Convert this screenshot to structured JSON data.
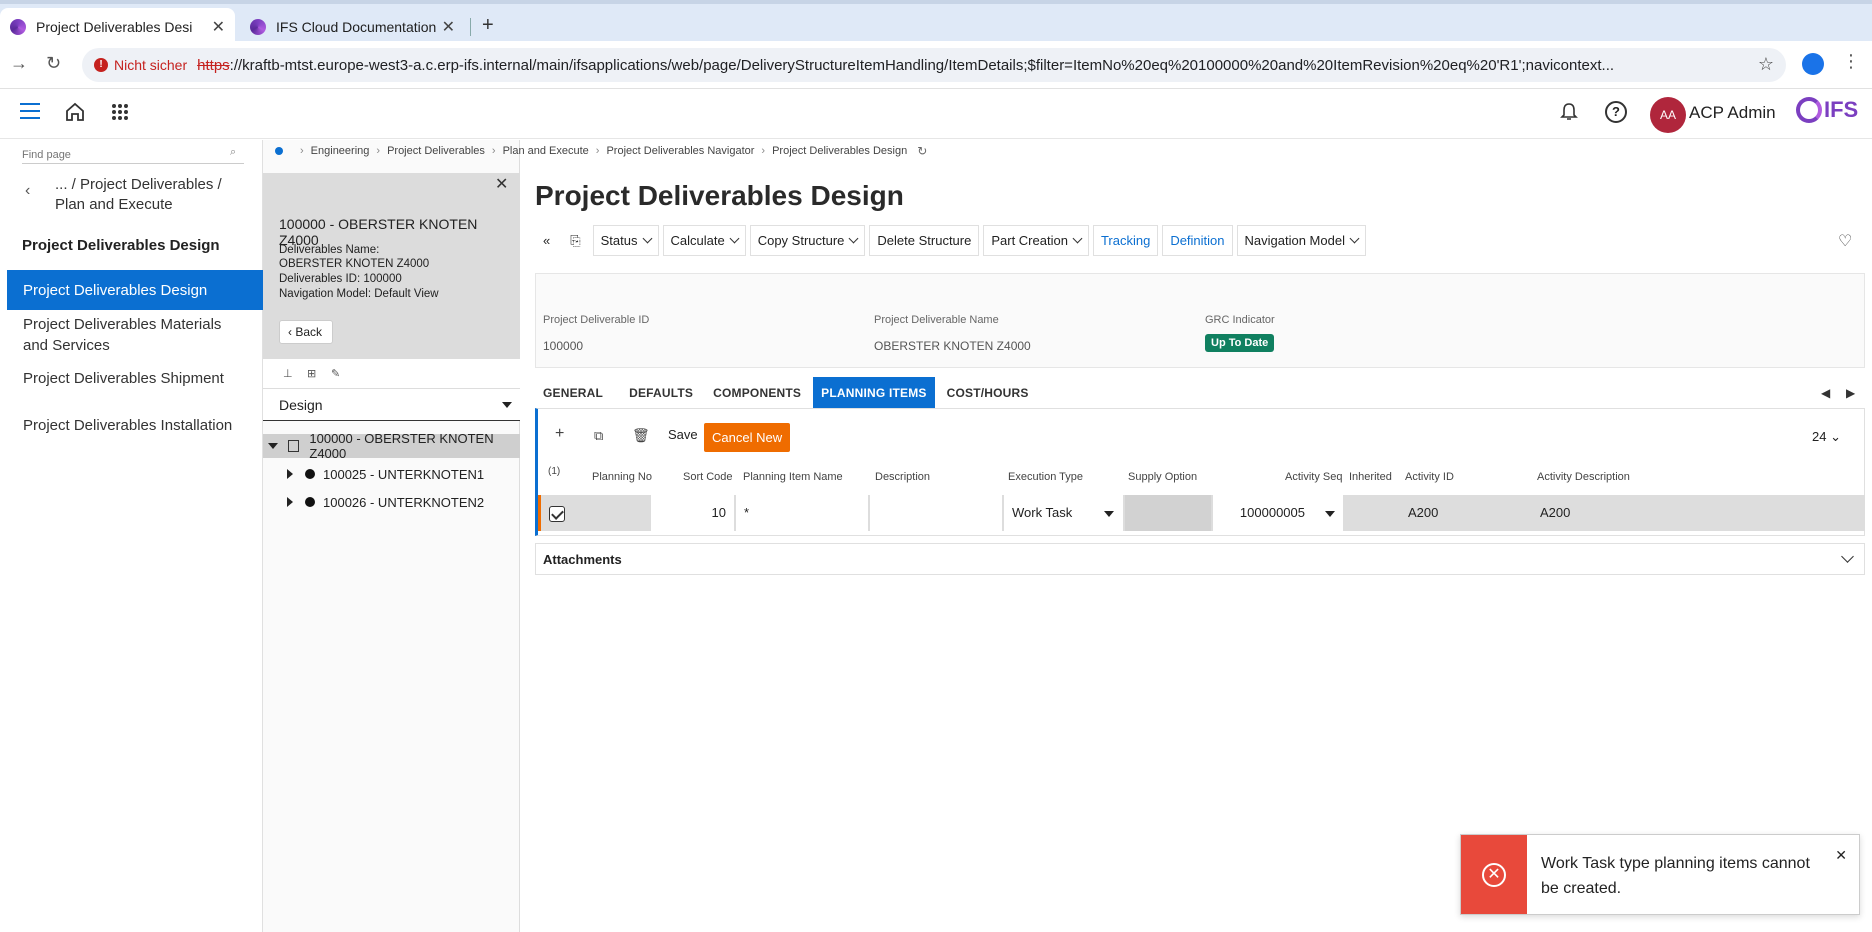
{
  "browser": {
    "tabs": [
      {
        "title": "Project Deliverables Desi",
        "active": true
      },
      {
        "title": "IFS Cloud Documentation",
        "active": false
      }
    ],
    "security_label": "Nicht sicher",
    "url_scheme": "https",
    "url_rest": "://kraftb-mtst.europe-west3-a.c.erp-ifs.internal/main/ifsapplications/web/page/DeliveryStructureItemHandling/ItemDetails;$filter=ItemNo%20eq%20100000%20and%20ItemRevision%20eq%20'R1';navicontext..."
  },
  "header": {
    "avatar_initials": "AA",
    "user_name": "ACP Admin",
    "logo_text": "IFS"
  },
  "leftnav": {
    "find_placeholder": "Find page",
    "path": "... / Project Deliverables / Plan and Execute",
    "title": "Project Deliverables Design",
    "items": [
      {
        "label": "Project Deliverables Design",
        "active": true
      },
      {
        "label": "Project Deliverables Materials and Services",
        "active": false
      },
      {
        "label": "Project Deliverables Shipment",
        "active": false
      },
      {
        "label": "Project Deliverables Installation",
        "active": false
      }
    ]
  },
  "midpanel": {
    "title": "100000 - OBERSTER KNOTEN Z4000",
    "info": [
      "Deliverables Name:",
      "OBERSTER KNOTEN Z4000",
      "Deliverables ID:   100000",
      "Navigation Model:   Default View"
    ],
    "back_label": "Back",
    "view": "Design",
    "tree": [
      {
        "label": "100000 - OBERSTER KNOTEN Z4000"
      },
      {
        "label": "100025 - UNTERKNOTEN1"
      },
      {
        "label": "100026 - UNTERKNOTEN2"
      }
    ]
  },
  "breadcrumb": [
    "Engineering",
    "Project Deliverables",
    "Plan and Execute",
    "Project Deliverables Navigator",
    "Project Deliverables Design"
  ],
  "page": {
    "title": "Project Deliverables Design",
    "commands": {
      "status": "Status",
      "calculate": "Calculate",
      "copy_structure": "Copy Structure",
      "delete_structure": "Delete Structure",
      "part_creation": "Part Creation",
      "tracking": "Tracking",
      "definition": "Definition",
      "navigation_model": "Navigation Model"
    },
    "header_fields": {
      "id_label": "Project Deliverable ID",
      "id_value": "100000",
      "name_label": "Project Deliverable Name",
      "name_value": "OBERSTER KNOTEN Z4000",
      "grc_label": "GRC Indicator",
      "grc_value": "Up To Date"
    },
    "tabs": [
      {
        "label": "GENERAL",
        "active": false
      },
      {
        "label": "DEFAULTS",
        "active": false
      },
      {
        "label": "COMPONENTS",
        "active": false
      },
      {
        "label": "PLANNING ITEMS",
        "active": true
      },
      {
        "label": "COST/HOURS",
        "active": false
      }
    ]
  },
  "grid": {
    "save_label": "Save",
    "cancel_new_label": "Cancel New",
    "page_size": "24",
    "selected_count": "(1)",
    "columns": [
      "Planning No",
      "Sort Code",
      "Planning Item Name",
      "Description",
      "Execution Type",
      "Supply Option",
      "Activity Seq",
      "Inherited",
      "Activity ID",
      "Activity Description"
    ],
    "row": {
      "planning_no": "",
      "sort_code": "10",
      "planning_item_name": "*",
      "description": "",
      "execution_type": "Work Task",
      "supply_option": "",
      "activity_seq": "100000005",
      "inherited": "",
      "activity_id": "A200",
      "activity_description": "A200"
    }
  },
  "attachments": {
    "title": "Attachments"
  },
  "toast": {
    "message": "Work Task type planning items cannot be created.",
    "color": "#e8493b"
  },
  "colors": {
    "accent": "#0b6fd1",
    "warning": "#ef6c00",
    "success": "#108060"
  }
}
